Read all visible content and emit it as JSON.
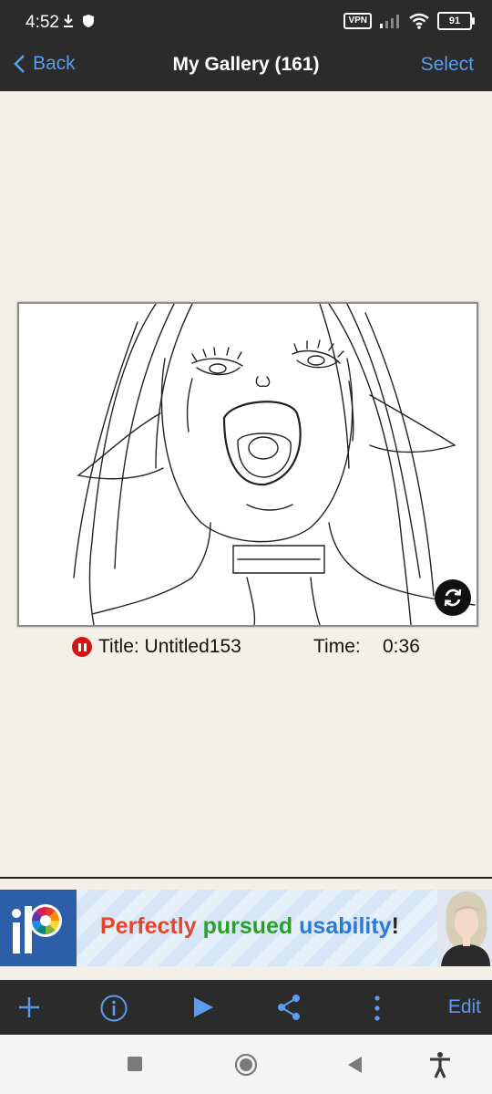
{
  "status": {
    "time": "4:52",
    "vpn": "VPN",
    "battery": "91"
  },
  "nav": {
    "back": "Back",
    "title": "My Gallery (161)",
    "select": "Select"
  },
  "artwork": {
    "title_label": "Title: Untitled153",
    "time_label": "Time:",
    "time_value": "0:36"
  },
  "ad": {
    "word1": "Perfectly",
    "word2": "pursued",
    "word3": "usability",
    "bang": "!"
  },
  "toolbar": {
    "edit": "Edit"
  },
  "colors": {
    "bar": "#2b2b2b",
    "accent": "#5b9cf0",
    "background": "#f3f1e7",
    "record": "#d41414"
  },
  "icons": [
    "download-icon",
    "shield-icon",
    "signal-icon",
    "wifi-icon",
    "battery-icon",
    "back-chevron-icon",
    "rotate-icon",
    "record-pause-icon",
    "plus-icon",
    "info-icon",
    "play-icon",
    "share-icon",
    "more-icon",
    "square-icon",
    "circle-icon",
    "triangle-icon",
    "accessibility-icon"
  ]
}
